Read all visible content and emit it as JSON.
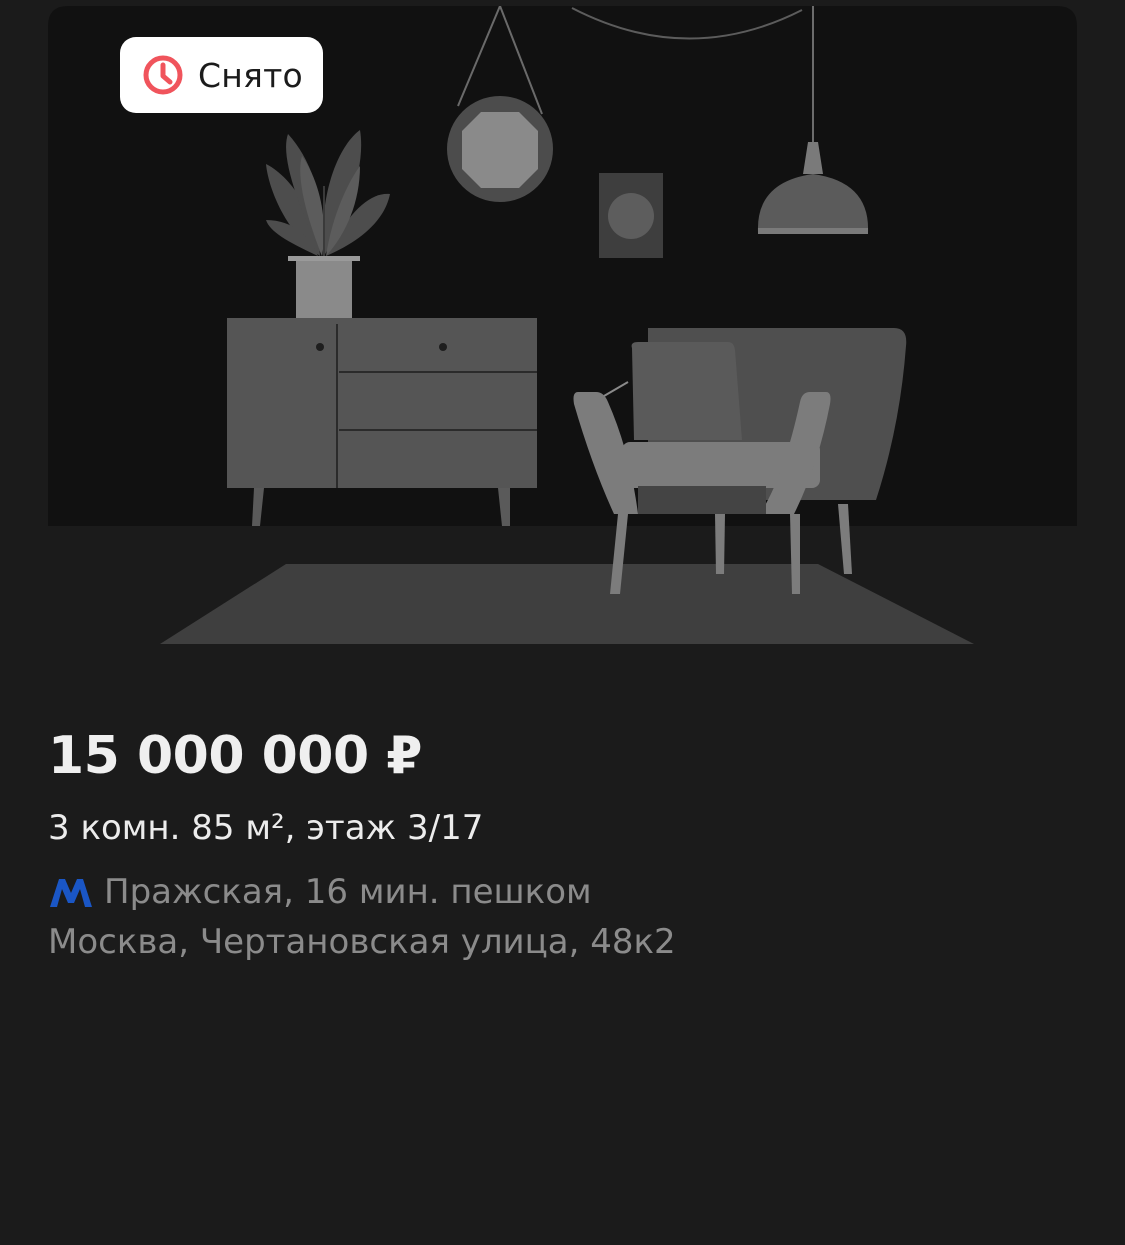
{
  "listing": {
    "status": "Снято",
    "status_icon": "clock-icon",
    "price": "15 000 000 ₽",
    "params": "3 комн. 85 м², этаж 3/17",
    "metro_icon": "metro-logo-icon",
    "metro": "Пражская, 16 мин. пешком",
    "address": "Москва, Чертановская улица, 48к2",
    "colors": {
      "status_accent": "#f0545c",
      "metro_blue": "#1a56c5",
      "background": "#1b1b1b"
    }
  }
}
